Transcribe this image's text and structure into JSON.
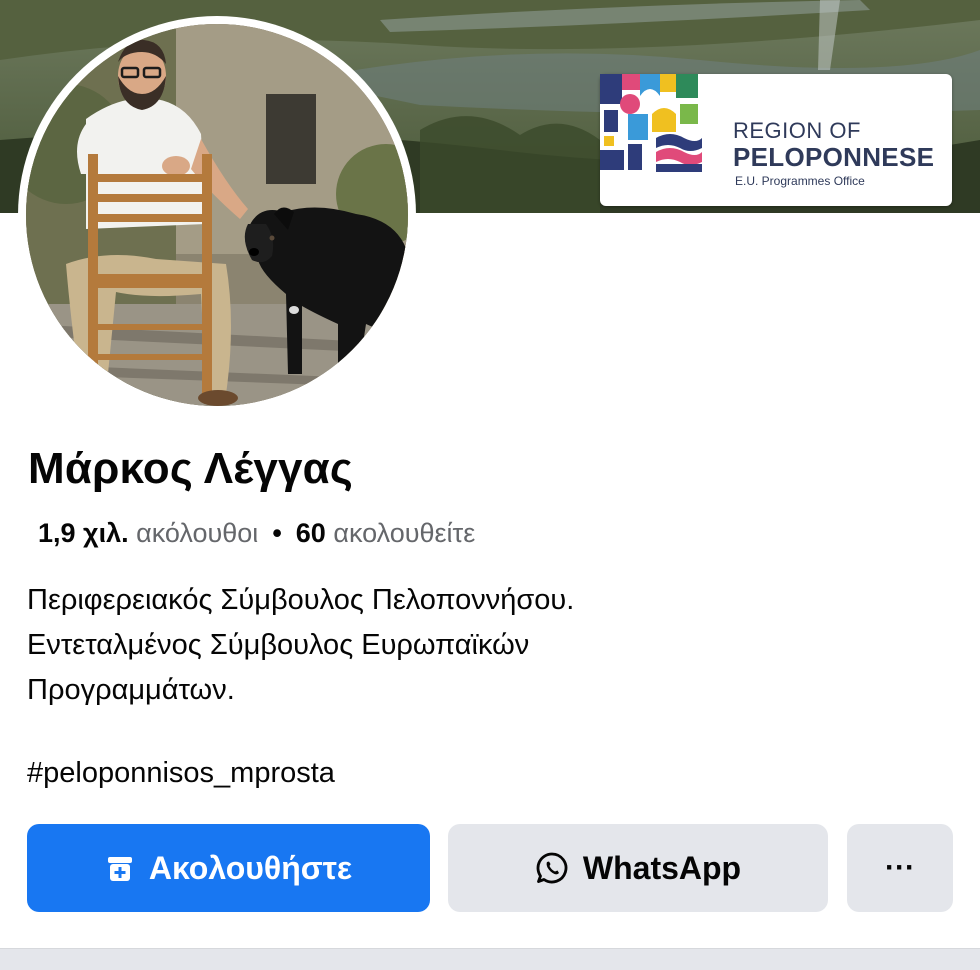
{
  "cover": {
    "logo": {
      "line1": "REGION OF",
      "line2": "PELOPONNESE",
      "line3": "E.U. Programmes Office"
    }
  },
  "profile": {
    "name": "Μάρκος Λέγγας",
    "followers_count": "1,9 χιλ.",
    "followers_label": "ακόλουθοι",
    "following_count": "60",
    "following_label": "ακολουθείτε",
    "bio": [
      "Περιφερειακός Σύμβουλος Πελοποννήσου.",
      "Εντεταλμένος Σύμβουλος Ευρωπαϊκών",
      "Προγραμμάτων."
    ],
    "hashtag": "#peloponnisos_mprosta"
  },
  "actions": {
    "follow_label": "Ακολουθήστε",
    "whatsapp_label": "WhatsApp",
    "more_label": "···"
  },
  "icons": {
    "follow": "follow-plus-icon",
    "whatsapp": "whatsapp-icon",
    "more": "more-dots-icon"
  },
  "colors": {
    "primary": "#1877f2",
    "secondary_button": "#e4e6eb",
    "text": "#050505",
    "muted_text": "#65676b"
  }
}
